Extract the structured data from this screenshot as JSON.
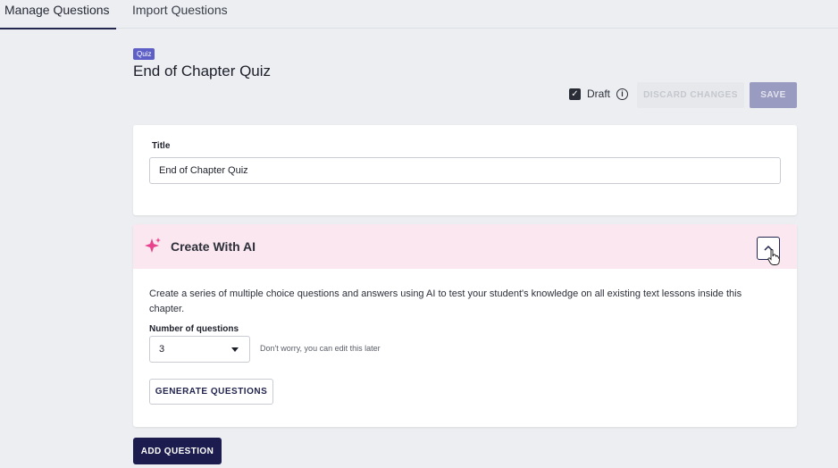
{
  "tabs": [
    {
      "label": "Manage Questions",
      "active": true
    },
    {
      "label": "Import Questions",
      "active": false
    }
  ],
  "header": {
    "badge": "Quiz",
    "title": "End of Chapter Quiz"
  },
  "toolbar": {
    "draft_label": "Draft",
    "draft_checked": true,
    "info_icon": "info-icon",
    "discard_label": "DISCARD CHANGES",
    "save_label": "SAVE"
  },
  "title_card": {
    "label": "Title",
    "value": "End of Chapter Quiz"
  },
  "ai_card": {
    "title": "Create With AI",
    "icon": "sparkle-icon",
    "description": "Create a series of multiple choice questions and answers using AI to test your student's knowledge on all existing text lessons inside this chapter.",
    "number_label": "Number of questions",
    "number_value": "3",
    "hint": "Don't worry, you can edit this later",
    "generate_label": "GENERATE QUESTIONS"
  },
  "footer": {
    "add_label": "ADD QUESTION"
  },
  "colors": {
    "accent": "#1c1d4e",
    "badge": "#5d5fc7",
    "ai_header_bg": "#fbe7ef",
    "sparkle": "#e8428c"
  }
}
